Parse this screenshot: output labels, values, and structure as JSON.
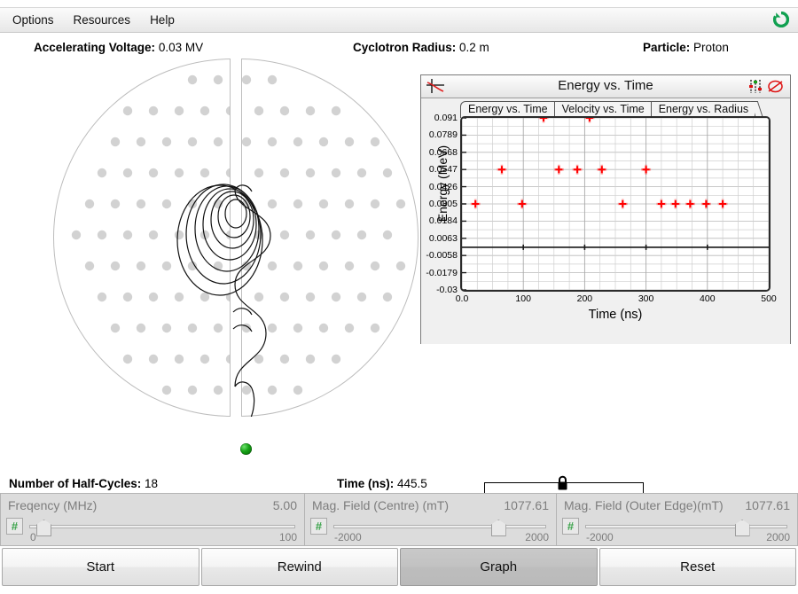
{
  "menu": {
    "items": [
      {
        "label": "Options"
      },
      {
        "label": "Resources"
      },
      {
        "label": "Help"
      }
    ],
    "recycle_icon": "recycle-icon",
    "recycle_color": "#10a050"
  },
  "header": {
    "voltage_label": "Accelerating Voltage:",
    "voltage_value": "0.03 MV",
    "radius_label": "Cyclotron Radius:",
    "radius_value": "0.2 m",
    "particle_label": "Particle:",
    "particle_value": "Proton"
  },
  "stage": {
    "dee_positive_label": "+",
    "dee_negative_label": "-",
    "particle_color": "#17a317",
    "dee_border_color": "#bdbdbd",
    "dot_color": "#d2d2d2",
    "trajectory_color": "#000000"
  },
  "graph": {
    "window_title": "Energy vs. Time",
    "icon_plot": "plot-curve-icon",
    "icon_sliders": "sliders-icon",
    "icon_noentry": "no-entry-icon",
    "tabs": [
      {
        "label": "Energy vs. Time",
        "selected": true
      },
      {
        "label": "Velocity vs. Time",
        "selected": false
      },
      {
        "label": "Energy vs. Radius",
        "selected": false
      }
    ]
  },
  "chart_data": {
    "type": "scatter",
    "title": "Energy vs. Time",
    "xlabel": "Time (ns)",
    "ylabel": "Energy (MeV)",
    "xlim": [
      0,
      500
    ],
    "ylim": [
      -0.03,
      0.091
    ],
    "grid": true,
    "legend": null,
    "marker": "plus",
    "marker_color": "#ff0000",
    "xticks": [
      0,
      100,
      200,
      300,
      400,
      500
    ],
    "xtick_labels": [
      "0.0",
      "100",
      "200",
      "300",
      "400",
      "500"
    ],
    "yticks": [
      0.091,
      0.0789,
      0.0668,
      0.0547,
      0.0426,
      0.0305,
      0.0184,
      0.0063,
      -0.0058,
      -0.0179,
      -0.03
    ],
    "ytick_labels": [
      "0.091",
      "0.0789",
      "0.0668",
      "0.0547",
      "0.0426",
      "0.0305",
      "0.0184",
      "0.0063",
      "-0.0058",
      "-0.0179",
      "-0.03"
    ],
    "zero_line": 0.0,
    "points": [
      {
        "x": 22,
        "y": 0.0305
      },
      {
        "x": 65,
        "y": 0.0547
      },
      {
        "x": 98,
        "y": 0.0305
      },
      {
        "x": 133,
        "y": 0.091
      },
      {
        "x": 158,
        "y": 0.0547
      },
      {
        "x": 188,
        "y": 0.0547
      },
      {
        "x": 208,
        "y": 0.091
      },
      {
        "x": 228,
        "y": 0.0547
      },
      {
        "x": 262,
        "y": 0.0305
      },
      {
        "x": 300,
        "y": 0.0547
      },
      {
        "x": 325,
        "y": 0.0305
      },
      {
        "x": 348,
        "y": 0.0305
      },
      {
        "x": 372,
        "y": 0.0305
      },
      {
        "x": 398,
        "y": 0.0305
      },
      {
        "x": 425,
        "y": 0.0305
      }
    ]
  },
  "status": {
    "halfcycles_label": "Number of Half-Cycles:",
    "halfcycles_value": "18",
    "time_label": "Time (ns):",
    "time_value": "445.5",
    "lock_icon": "lock-icon"
  },
  "sliders": [
    {
      "name": "Freqency (MHz)",
      "value": "5.00",
      "min": "0",
      "max": "100",
      "fill_pct": 5,
      "icon": "numeric-keypad-icon"
    },
    {
      "name": "Mag. Field (Centre) (mT)",
      "value": "1077.61",
      "min": "-2000",
      "max": "2000",
      "fill_pct": 77,
      "icon": "numeric-keypad-icon"
    },
    {
      "name": "Mag. Field (Outer Edge)(mT)",
      "value": "1077.61",
      "min": "-2000",
      "max": "2000",
      "fill_pct": 77,
      "icon": "numeric-keypad-icon"
    }
  ],
  "buttons": [
    {
      "label": "Start",
      "pressed": false
    },
    {
      "label": "Rewind",
      "pressed": false
    },
    {
      "label": "Graph",
      "pressed": true
    },
    {
      "label": "Reset",
      "pressed": false
    }
  ]
}
